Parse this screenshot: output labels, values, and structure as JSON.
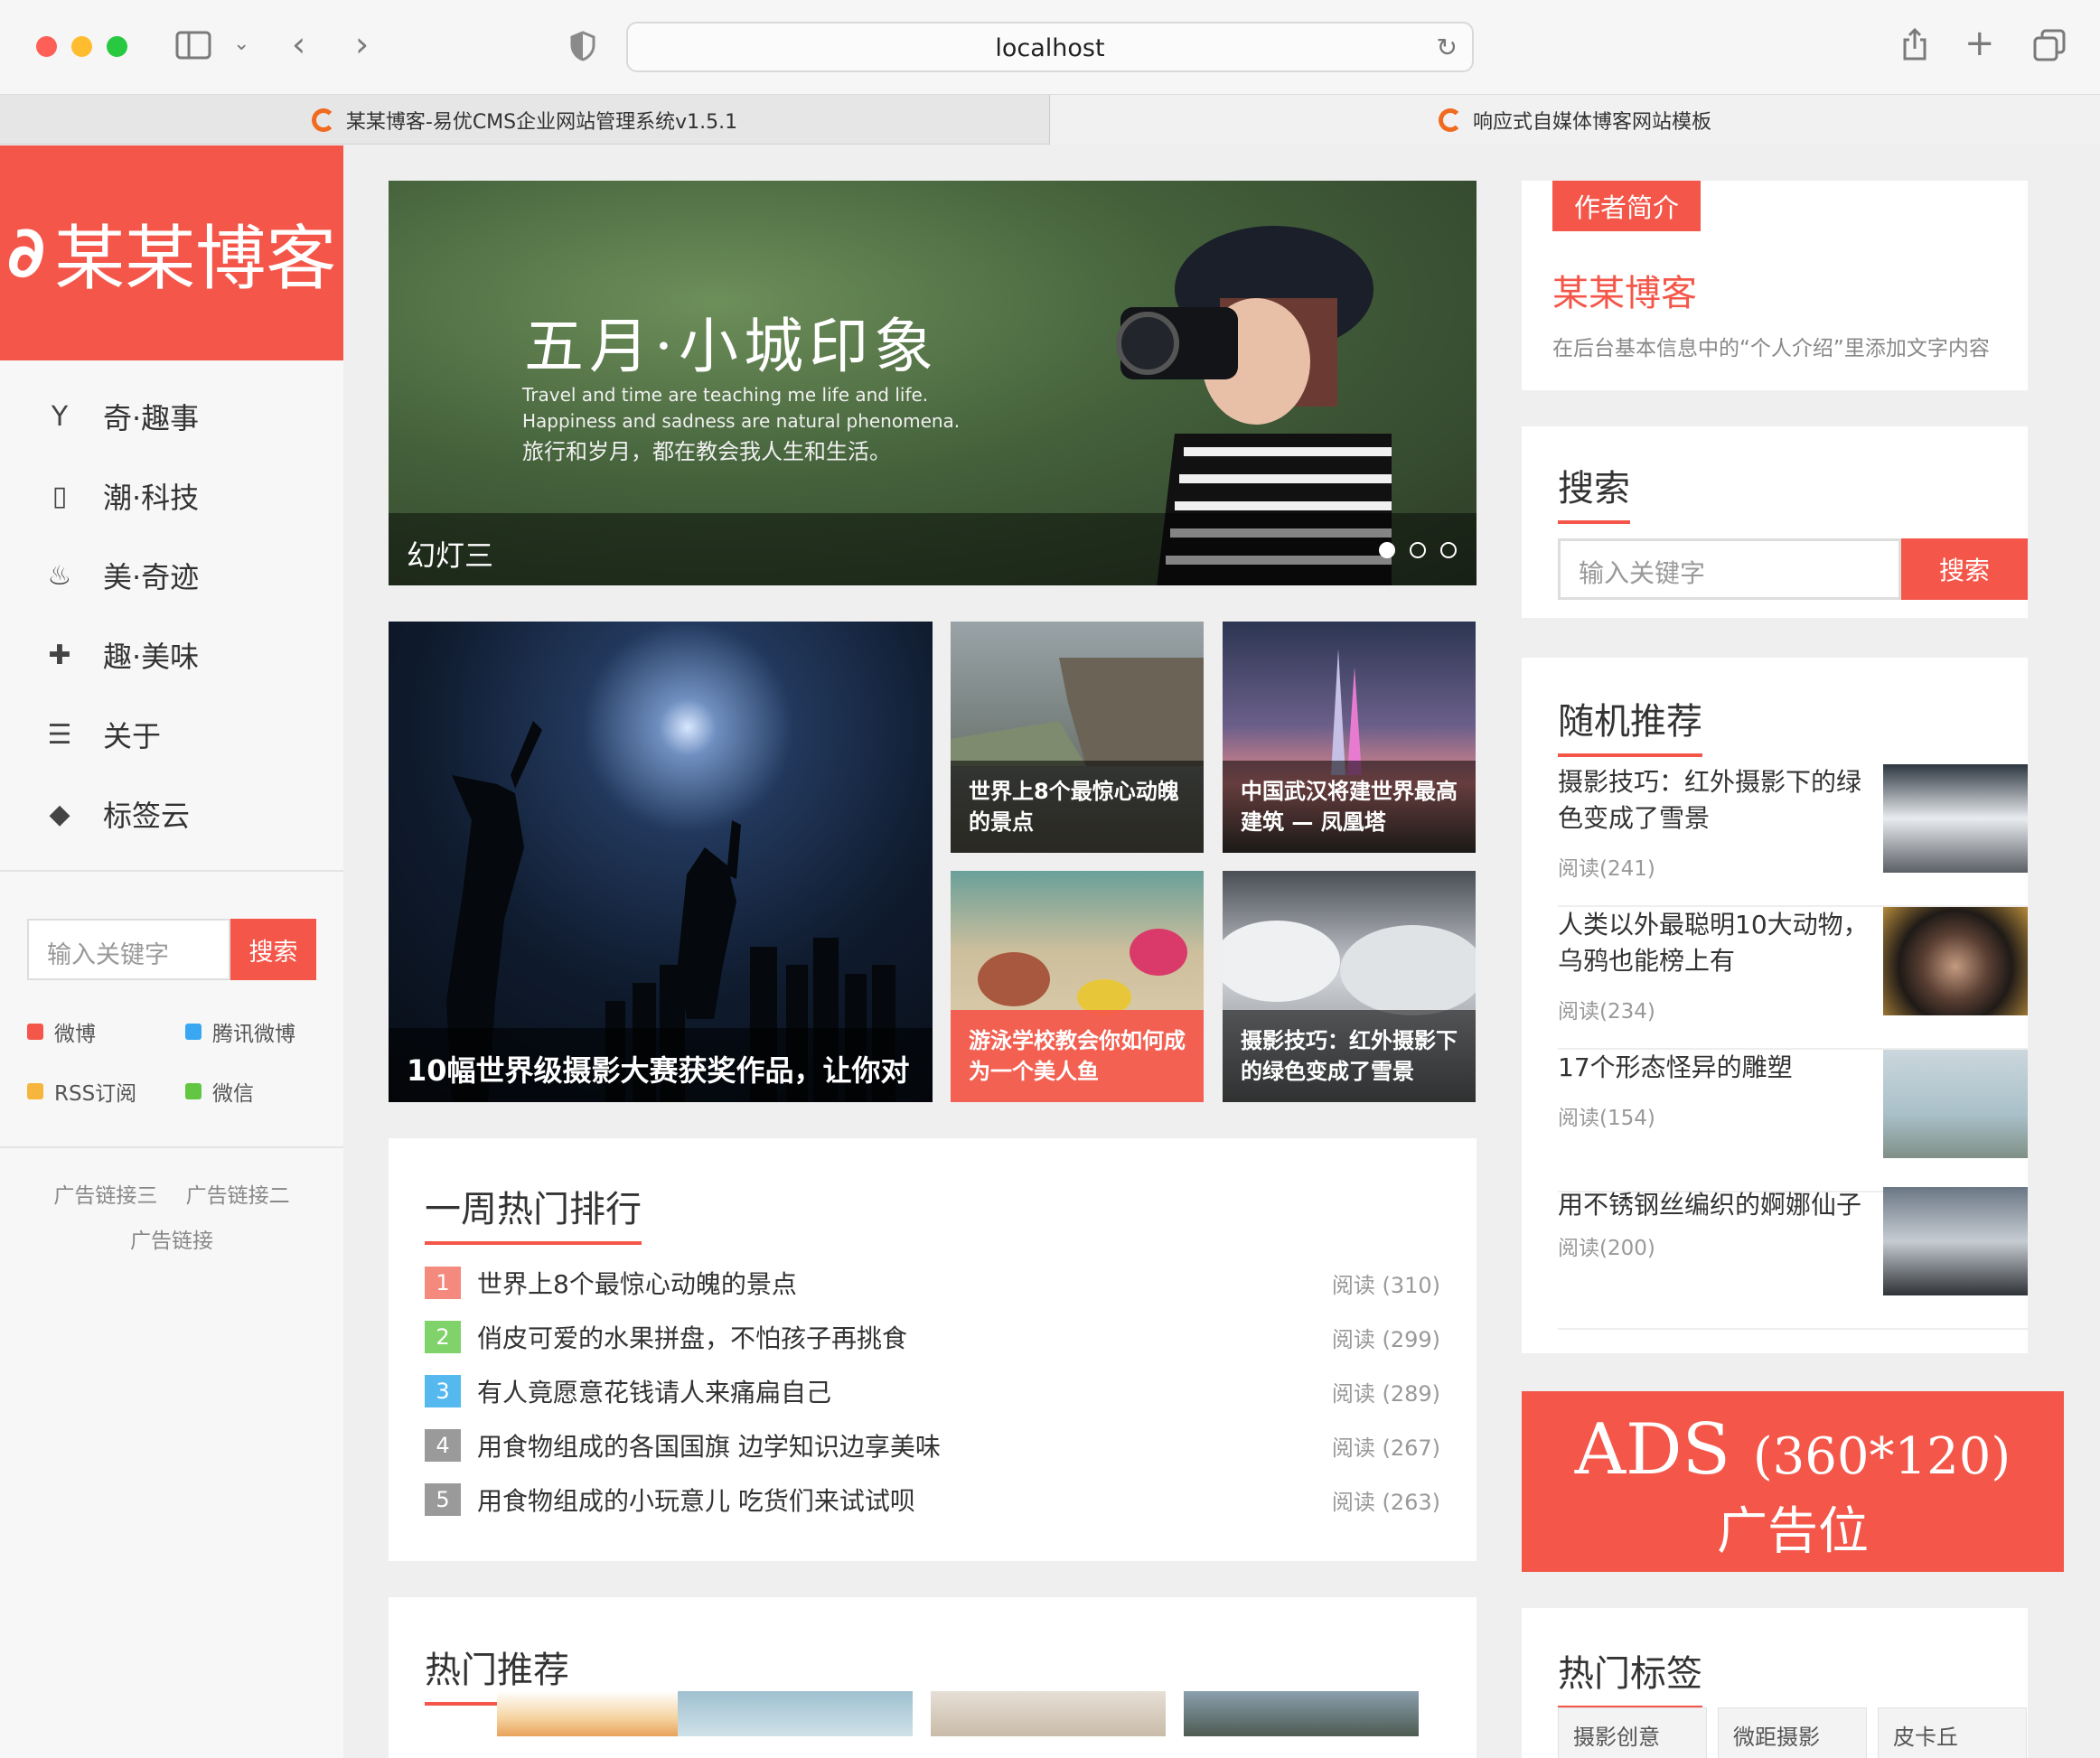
{
  "browser": {
    "url": "localhost",
    "tabs": [
      {
        "label": "某某博客-易优CMS企业网站管理系统v1.5.1"
      },
      {
        "label": "响应式自媒体博客网站模板"
      }
    ]
  },
  "sidebar": {
    "logo_text": "某某博客",
    "nav": [
      {
        "label": "奇·趣事",
        "icon": "cocktail-icon"
      },
      {
        "label": "潮·科技",
        "icon": "mobile-icon"
      },
      {
        "label": "美·奇迹",
        "icon": "fire-icon"
      },
      {
        "label": "趣·美味",
        "icon": "gift-icon"
      },
      {
        "label": "关于",
        "icon": "list-icon"
      },
      {
        "label": "标签云",
        "icon": "tag-icon"
      }
    ],
    "search": {
      "placeholder": "输入关键字",
      "button": "搜索"
    },
    "social": [
      {
        "label": "微博",
        "color": "#f4574a"
      },
      {
        "label": "腾讯微博",
        "color": "#3aa7f2"
      },
      {
        "label": "RSS订阅",
        "color": "#f6b53c"
      },
      {
        "label": "微信",
        "color": "#62c643"
      }
    ],
    "ad_links": [
      "广告链接三",
      "广告链接二",
      "广告链接"
    ]
  },
  "slider": {
    "headline": "五月·小城印象",
    "sub1": "Travel and time are teaching me life and life.",
    "sub2": "Happiness and sadness are natural phenomena.",
    "sub3": "旅行和岁月，都在教会我人生和生活。",
    "caption": "幻灯三",
    "active_dot": 1
  },
  "featured": {
    "big": "10幅世界级摄影大赛获奖作品，让你对",
    "tiles": [
      {
        "title": "世界上8个最惊心动魄的景点"
      },
      {
        "title": "中国武汉将建世界最高建筑 — 凤凰塔"
      },
      {
        "title": "游泳学校教会你如何成为一个美人鱼"
      },
      {
        "title": "摄影技巧：红外摄影下的绿色变成了雪景"
      }
    ]
  },
  "ranking": {
    "title": "一周热门排行",
    "items": [
      {
        "num": "1",
        "title": "世界上8个最惊心动魄的景点",
        "count": "阅读 (310)",
        "color": "#f48a7e"
      },
      {
        "num": "2",
        "title": "俏皮可爱的水果拼盘，不怕孩子再挑食",
        "count": "阅读 (299)",
        "color": "#7fd36a"
      },
      {
        "num": "3",
        "title": "有人竟愿意花钱请人来痛扁自己",
        "count": "阅读 (289)",
        "color": "#55b8ee"
      },
      {
        "num": "4",
        "title": "用食物组成的各国国旗 边学知识边享美味",
        "count": "阅读 (267)",
        "color": "#9a9a9a"
      },
      {
        "num": "5",
        "title": "用食物组成的小玩意儿 吃货们来试试呗",
        "count": "阅读 (263)",
        "color": "#9a9a9a"
      }
    ]
  },
  "hot": {
    "title": "热门推荐"
  },
  "author": {
    "tag": "作者简介",
    "name": "某某博客",
    "desc": "在后台基本信息中的“个人介绍”里添加文字内容"
  },
  "right_search": {
    "title": "搜索",
    "placeholder": "输入关键字",
    "button": "搜索"
  },
  "random": {
    "title": "随机推荐",
    "items": [
      {
        "title": "摄影技巧：红外摄影下的绿色变成了雪景",
        "count": "阅读(241)"
      },
      {
        "title": "人类以外最聪明10大动物，乌鸦也能榜上有",
        "count": "阅读(234)"
      },
      {
        "title": "17个形态怪异的雕塑",
        "count": "阅读(154)"
      },
      {
        "title": "用不锈钢丝编织的婀娜仙子",
        "count": "阅读(200)"
      }
    ]
  },
  "ad": {
    "line1": "ADS",
    "size": "(360*120)",
    "line2": "广告位"
  },
  "tags": {
    "title": "热门标签",
    "items": [
      "摄影创意",
      "微距摄影",
      "皮卡丘"
    ]
  }
}
